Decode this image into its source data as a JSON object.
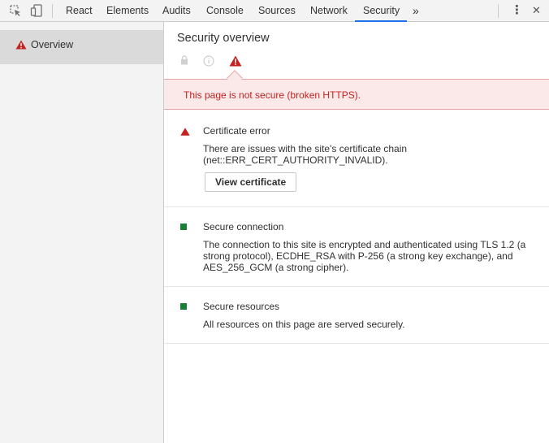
{
  "toolbar": {
    "tabs": [
      {
        "label": "React"
      },
      {
        "label": "Elements"
      },
      {
        "label": "Audits"
      },
      {
        "label": "Console"
      },
      {
        "label": "Sources"
      },
      {
        "label": "Network"
      },
      {
        "label": "Security",
        "active": true
      }
    ],
    "more_tabs_glyph": "»",
    "menu_glyph": "⋮",
    "close_glyph": "✕"
  },
  "sidebar": {
    "items": [
      {
        "label": "Overview",
        "icon": "warning-triangle-icon",
        "selected": true
      }
    ]
  },
  "main": {
    "title": "Security overview",
    "summary_icons": [
      "lock-icon",
      "info-circle-icon",
      "warning-triangle-icon"
    ],
    "banner": "This page is not secure (broken HTTPS).",
    "sections": [
      {
        "status": "error",
        "title": "Certificate error",
        "description": "There are issues with the site's certificate chain (net::ERR_CERT_AUTHORITY_INVALID).",
        "button": "View certificate"
      },
      {
        "status": "secure",
        "title": "Secure connection",
        "description": "The connection to this site is encrypted and authenticated using TLS 1.2 (a strong protocol), ECDHE_RSA with P-256 (a strong key exchange), and AES_256_GCM (a strong cipher)."
      },
      {
        "status": "secure",
        "title": "Secure resources",
        "description": "All resources on this page are served securely."
      }
    ]
  },
  "colors": {
    "accent": "#1a73e8",
    "error": "#c5221f",
    "secure": "#188038",
    "banner_bg": "#fbe9e9"
  }
}
